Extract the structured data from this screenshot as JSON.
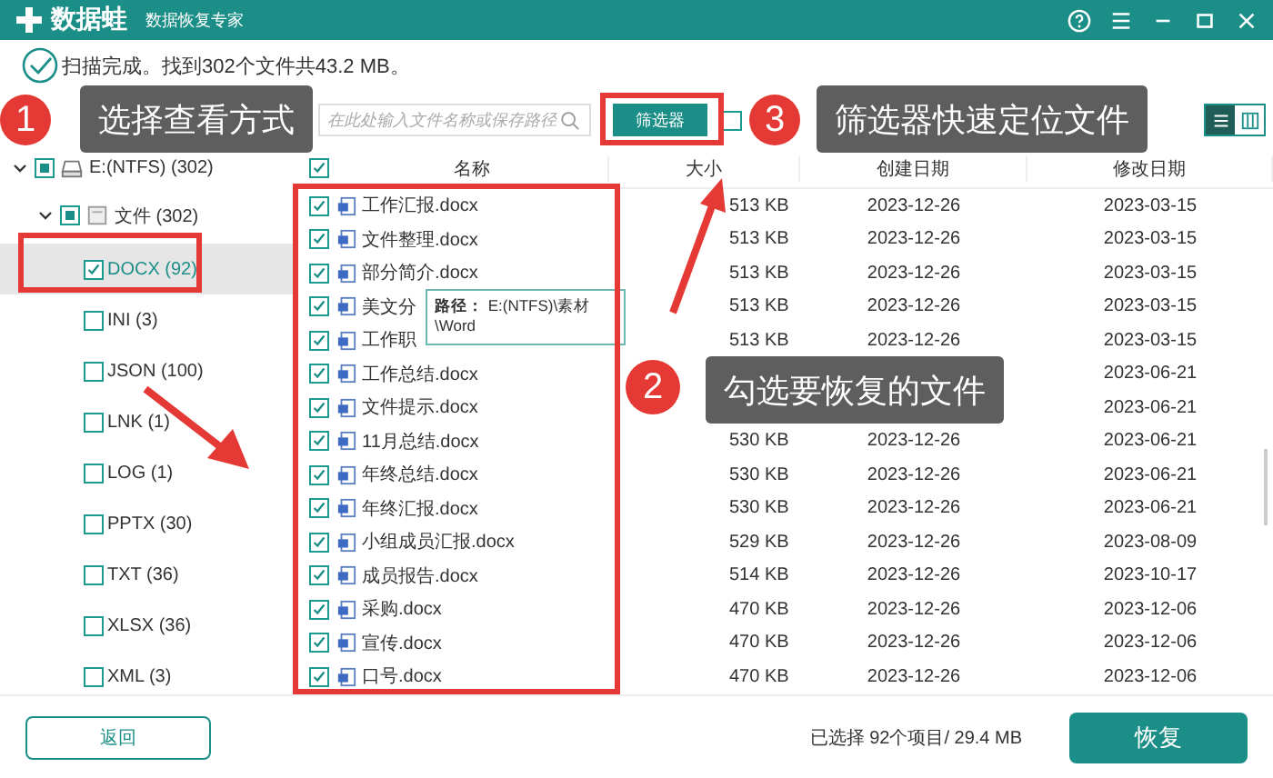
{
  "window": {
    "app_name": "数据蛙",
    "subtitle": "数据恢复专家"
  },
  "scan_status": "扫描完成。找到302个文件共43.2 MB。",
  "toolbar": {
    "search": {
      "placeholder": "在此处输入文件名称或保存路径"
    },
    "filter_button": "筛选器",
    "show_deleted": {
      "checked": false
    },
    "view_modes": [
      {
        "kind": "list",
        "selected": true
      },
      {
        "kind": "columns",
        "selected": false
      }
    ]
  },
  "tree": {
    "label": "E:(NTFS) (302)",
    "expanded": true,
    "partial": true,
    "children": [
      {
        "label": "文件 (302)",
        "expanded": true,
        "partial": true,
        "children": [
          {
            "label": "DOCX (92)",
            "checked": true,
            "selected": true
          },
          {
            "label": "INI (3)",
            "checked": false,
            "selected": false
          },
          {
            "label": "JSON (100)",
            "checked": false,
            "selected": false
          },
          {
            "label": "LNK (1)",
            "checked": false,
            "selected": false
          },
          {
            "label": "LOG (1)",
            "checked": false,
            "selected": false
          },
          {
            "label": "PPTX (30)",
            "checked": false,
            "selected": false
          },
          {
            "label": "TXT (36)",
            "checked": false,
            "selected": false
          },
          {
            "label": "XLSX (36)",
            "checked": false,
            "selected": false
          },
          {
            "label": "XML (3)",
            "checked": false,
            "selected": false
          }
        ]
      }
    ]
  },
  "table": {
    "all_checked": true,
    "columns": [
      "名称",
      "大小",
      "创建日期",
      "修改日期"
    ],
    "rows": [
      {
        "name": "工作汇报.docx",
        "size": "513 KB",
        "created": "2023-12-26",
        "modified": "2023-03-15",
        "checked": true
      },
      {
        "name": "文件整理.docx",
        "size": "513 KB",
        "created": "2023-12-26",
        "modified": "2023-03-15",
        "checked": true
      },
      {
        "name": "部分简介.docx",
        "size": "513 KB",
        "created": "2023-12-26",
        "modified": "2023-03-15",
        "checked": true
      },
      {
        "name": "美文分",
        "size": "513 KB",
        "created": "2023-12-26",
        "modified": "2023-03-15",
        "checked": true
      },
      {
        "name": "工作职",
        "size": "513 KB",
        "created": "2023-12-26",
        "modified": "2023-03-15",
        "checked": true
      },
      {
        "name": "工作总结.docx",
        "modified": "2023-06-21",
        "checked": true
      },
      {
        "name": "文件提示.docx",
        "modified": "2023-06-21",
        "checked": true
      },
      {
        "name": "11月总结.docx",
        "size": "530 KB",
        "created": "2023-12-26",
        "modified": "2023-06-21",
        "checked": true
      },
      {
        "name": "年终总结.docx",
        "size": "530 KB",
        "created": "2023-12-26",
        "modified": "2023-06-21",
        "checked": true
      },
      {
        "name": "年终汇报.docx",
        "size": "530 KB",
        "created": "2023-12-26",
        "modified": "2023-06-21",
        "checked": true
      },
      {
        "name": "小组成员汇报.docx",
        "size": "529 KB",
        "created": "2023-12-26",
        "modified": "2023-08-09",
        "checked": true
      },
      {
        "name": "成员报告.docx",
        "size": "514 KB",
        "created": "2023-12-26",
        "modified": "2023-10-17",
        "checked": true
      },
      {
        "name": "采购.docx",
        "size": "470 KB",
        "created": "2023-12-26",
        "modified": "2023-12-06",
        "checked": true
      },
      {
        "name": "宣传.docx",
        "size": "470 KB",
        "created": "2023-12-26",
        "modified": "2023-12-06",
        "checked": true
      },
      {
        "name": "口号.docx",
        "size": "470 KB",
        "created": "2023-12-26",
        "modified": "2023-12-06",
        "checked": true
      }
    ]
  },
  "tooltip": {
    "label": "路径：",
    "path": "E:(NTFS)\\素材\\Word"
  },
  "footer": {
    "back_button": "返回",
    "selection": "已选择 92个项目/ 29.4 MB",
    "recover_button": "恢复"
  },
  "annotations": [
    {
      "number": "1",
      "text": "选择查看方式"
    },
    {
      "number": "2",
      "text": "勾选要恢复的文件"
    },
    {
      "number": "3",
      "text": "筛选器快速定位文件"
    }
  ]
}
